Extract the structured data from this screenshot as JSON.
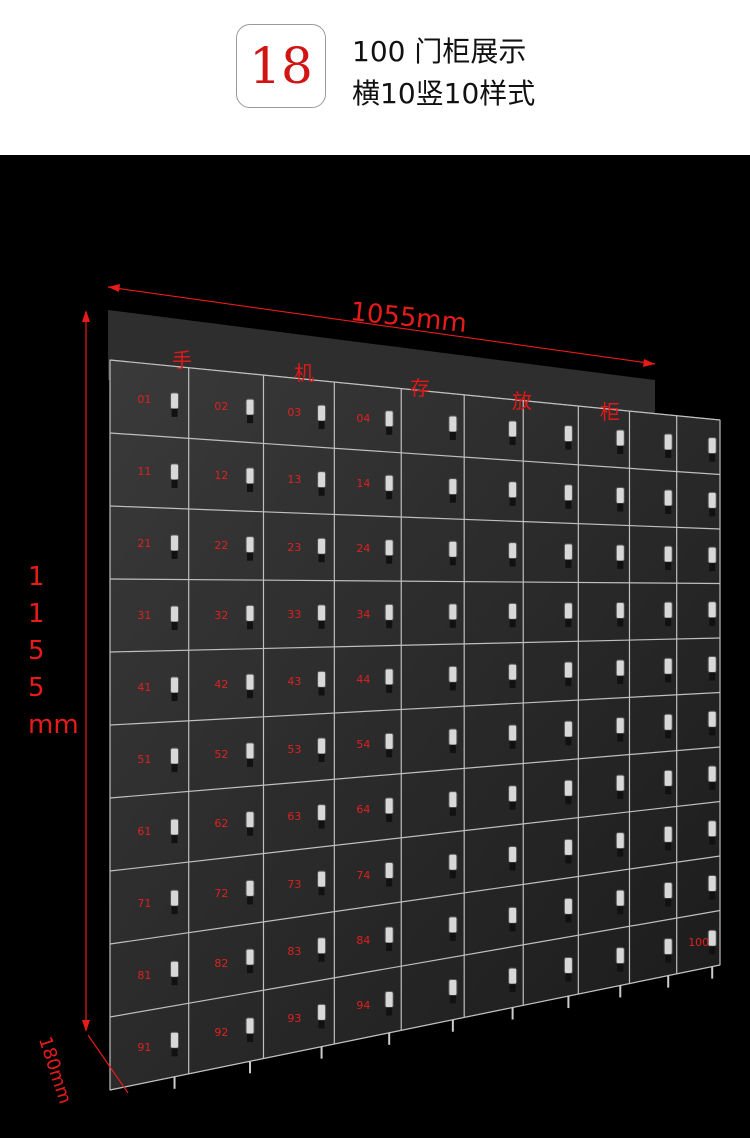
{
  "badge": {
    "number": "18"
  },
  "title": {
    "line1": "100 门柜展示",
    "line2": "横10竖10样式"
  },
  "dimensions": {
    "width": "1055mm",
    "height_digits": [
      "1",
      "1",
      "5",
      "5"
    ],
    "height_unit": "mm",
    "depth": "180mm"
  },
  "sign_text": [
    "手",
    "机",
    "存",
    "放",
    "柜"
  ],
  "cell_labels_visible": [
    "01",
    "11",
    "21",
    "31",
    "41",
    "51",
    "61",
    "71",
    "81",
    "91",
    "02",
    "12",
    "22",
    "32",
    "42",
    "52",
    "62",
    "72",
    "82",
    "92",
    "03",
    "13",
    "23",
    "33",
    "43",
    "53",
    "63",
    "73",
    "83",
    "93",
    "04",
    "14",
    "24",
    "34",
    "44",
    "54",
    "64",
    "74",
    "84",
    "94",
    "100"
  ],
  "colors": {
    "accent": "#e81b1b",
    "background": "#000000",
    "badge_number": "#d11414"
  }
}
